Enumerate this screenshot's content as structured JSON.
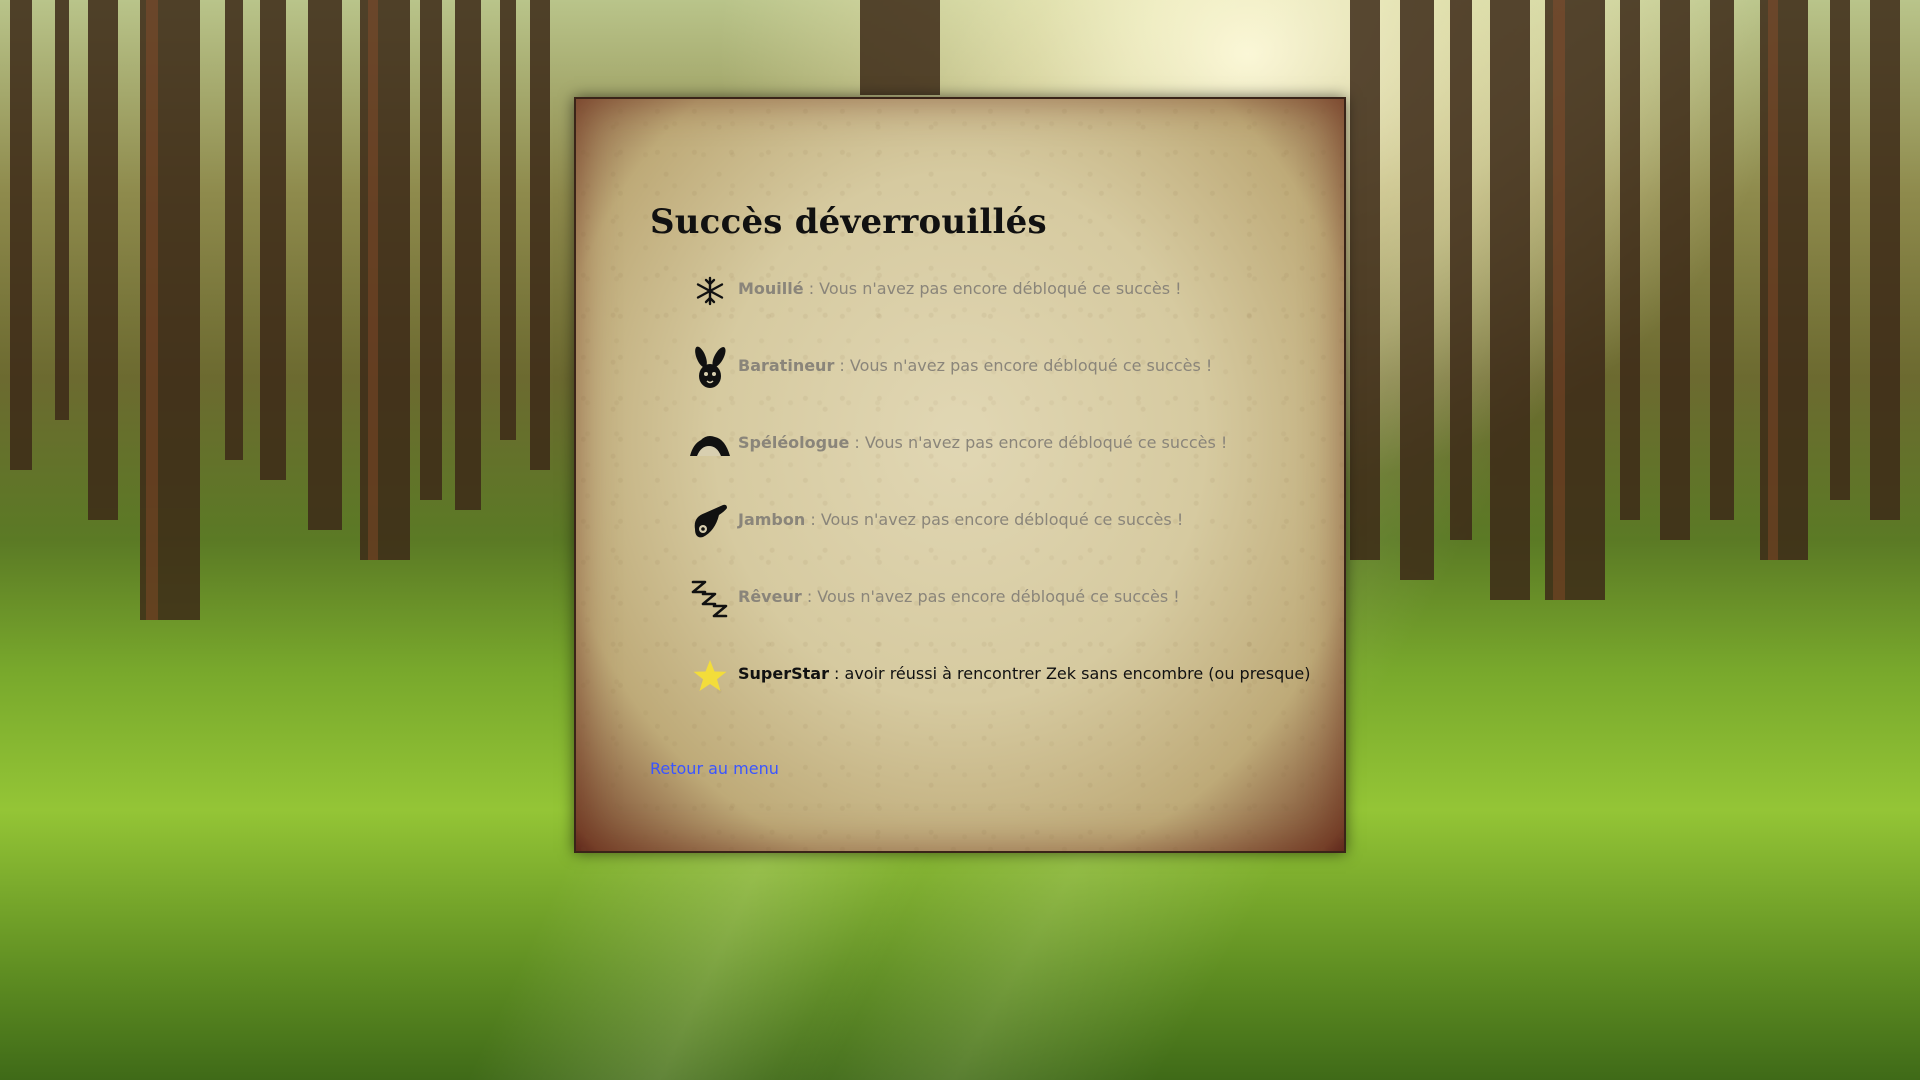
{
  "panel": {
    "title": "Succès déverrouillés",
    "back_label": "Retour au menu"
  },
  "achievements": [
    {
      "name": "Mouillé",
      "separator": " : ",
      "text": "Vous n'avez pas encore débloqué ce succès !",
      "icon": "snowflake-icon",
      "unlocked": false
    },
    {
      "name": "Baratineur",
      "separator": " : ",
      "text": "Vous n'avez pas encore débloqué ce succès !",
      "icon": "rabbit-icon",
      "unlocked": false
    },
    {
      "name": "Spéléologue",
      "separator": " : ",
      "text": "Vous n'avez pas encore débloqué ce succès !",
      "icon": "cave-icon",
      "unlocked": false
    },
    {
      "name": "Jambon",
      "separator": " : ",
      "text": "Vous n'avez pas encore débloqué ce succès !",
      "icon": "ham-icon",
      "unlocked": false
    },
    {
      "name": "Rêveur",
      "separator": " : ",
      "text": "Vous n'avez pas encore débloqué ce succès !",
      "icon": "sleep-zzz-icon",
      "unlocked": false
    },
    {
      "name": "SuperStar",
      "separator": " : ",
      "text": "avoir réussi à rencontrer Zek sans encombre (ou presque)",
      "icon": "star-icon",
      "unlocked": true
    }
  ],
  "colors": {
    "locked_text": "#8a857a",
    "unlocked_text": "#111111",
    "link": "#3a55ff",
    "star": "#f3dd3a"
  }
}
